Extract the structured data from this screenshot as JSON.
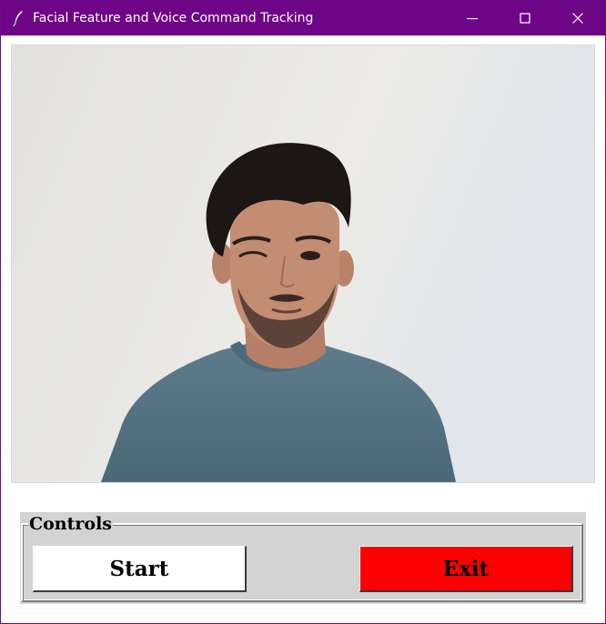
{
  "window": {
    "title": "Facial Feature and Voice Command Tracking",
    "icon": "feather-icon",
    "buttons": [
      "minimize-icon",
      "maximize-icon",
      "close-icon"
    ],
    "titlebar_color": "#6d0586"
  },
  "video": {
    "content": "webcam-feed"
  },
  "controls": {
    "label": "Controls",
    "start_label": "Start",
    "exit_label": "Exit",
    "start_color": "#ffffff",
    "exit_color": "#ff0000",
    "panel_color": "#d3d3d3"
  }
}
